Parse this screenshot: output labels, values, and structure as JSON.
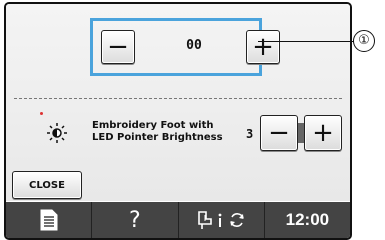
{
  "adjust": {
    "minus": "−",
    "plus": "+",
    "value": "00"
  },
  "led": {
    "label_line1": "Embroidery Foot with",
    "label_line2": "LED Pointer Brightness",
    "value": "3",
    "minus": "−",
    "plus": "+"
  },
  "close_label": "CLOSE",
  "statusbar": {
    "help": "?",
    "time": "12:00"
  },
  "callout": "①",
  "colors": {
    "highlight": "#4aa3dc",
    "statusbar": "#444444",
    "indicator_dot": "#dd3333"
  },
  "icons": [
    "brightness-icon",
    "document-icon",
    "help-icon",
    "presser-foot-icon",
    "rotate-icon"
  ]
}
